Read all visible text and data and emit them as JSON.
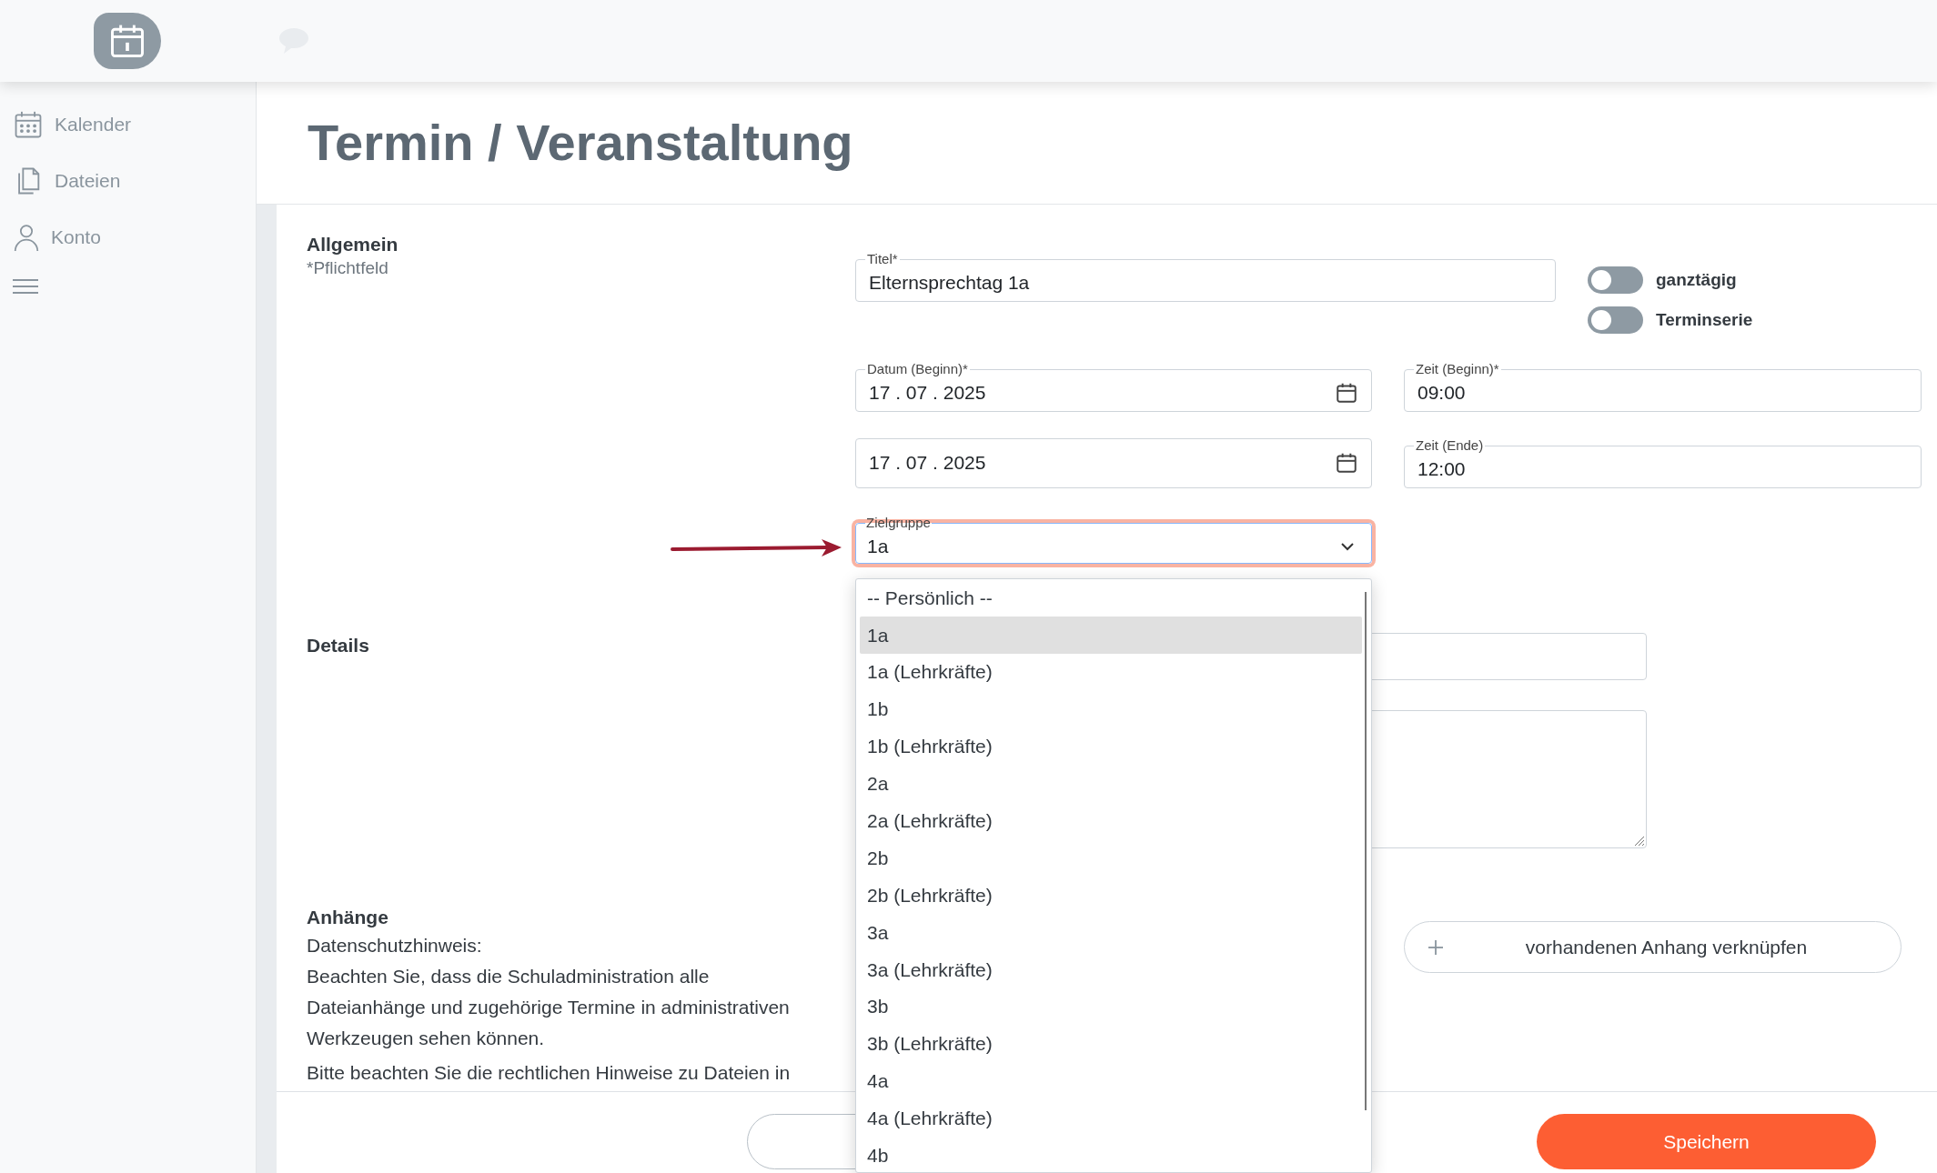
{
  "sidebar": {
    "items": [
      {
        "label": "Kalender",
        "kind": "calendar"
      },
      {
        "label": "Dateien",
        "kind": "files"
      },
      {
        "label": "Konto",
        "kind": "account"
      }
    ]
  },
  "page_title": "Termin / Veranstaltung",
  "general": {
    "heading": "Allgemein",
    "note": "*Pflichtfeld",
    "title_field": {
      "label": "Titel*",
      "value": "Elternsprechtag 1a"
    },
    "toggles": [
      {
        "label": "ganztägig",
        "on": false
      },
      {
        "label": "Terminserie",
        "on": false
      }
    ],
    "start_date": {
      "label": "Datum (Beginn)*",
      "value": "17 . 07 . 2025"
    },
    "start_time": {
      "label": "Zeit (Beginn)*",
      "value": "09:00"
    },
    "end_date": {
      "value": "17 . 07 . 2025"
    },
    "end_time": {
      "label": "Zeit (Ende)",
      "value": "12:00"
    },
    "target_group": {
      "label": "Zielgruppe",
      "value": "1a",
      "expanded": true,
      "options": [
        {
          "label": "-- Persönlich --",
          "selected": false
        },
        {
          "label": "1a",
          "selected": true
        },
        {
          "label": "1a (Lehrkräfte)",
          "selected": false
        },
        {
          "label": "1b",
          "selected": false
        },
        {
          "label": "1b (Lehrkräfte)",
          "selected": false
        },
        {
          "label": "2a",
          "selected": false
        },
        {
          "label": "2a (Lehrkräfte)",
          "selected": false
        },
        {
          "label": "2b",
          "selected": false
        },
        {
          "label": "2b (Lehrkräfte)",
          "selected": false
        },
        {
          "label": "3a",
          "selected": false
        },
        {
          "label": "3a (Lehrkräfte)",
          "selected": false
        },
        {
          "label": "3b",
          "selected": false
        },
        {
          "label": "3b (Lehrkräfte)",
          "selected": false
        },
        {
          "label": "4a",
          "selected": false
        },
        {
          "label": "4a (Lehrkräfte)",
          "selected": false
        },
        {
          "label": "4b",
          "selected": false
        }
      ]
    }
  },
  "details": {
    "heading": "Details"
  },
  "attachments": {
    "heading": "Anhänge",
    "paragraphs": [
      "Datenschutzhinweis:",
      "Beachten Sie, dass die Schuladministration alle Dateianhänge und zugehörige Termine in administrativen Werkzeugen sehen können.",
      "Bitte beachten Sie die rechtlichen Hinweise zu Dateien in"
    ],
    "link_button": "vorhandenen Anhang verknüpfen"
  },
  "footer": {
    "save_button": "Speichern"
  }
}
